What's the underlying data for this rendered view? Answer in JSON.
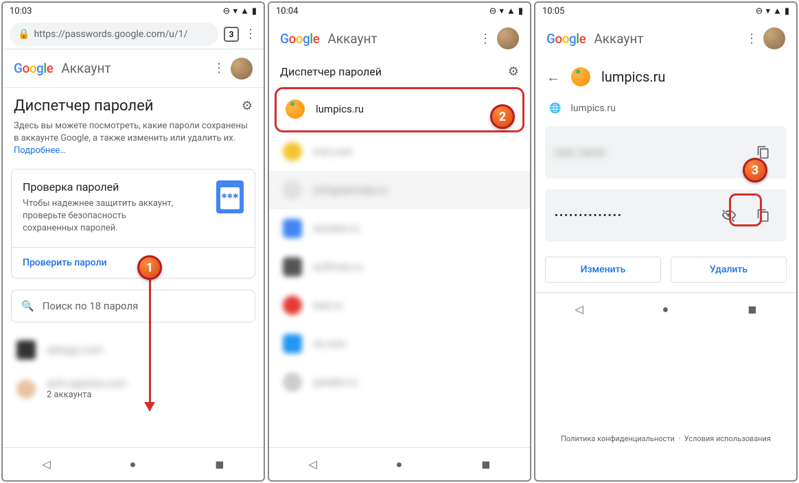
{
  "screen1": {
    "time": "10:03",
    "url": "https://passwords.google.com/u/1/",
    "tab_count": "3",
    "brand": "Аккаунт",
    "title": "Диспетчер паролей",
    "description": "Здесь вы можете посмотреть, какие пароли сохранены в аккаунте Google, а также изменить или удалить их.",
    "learn_more": "Подробнее…",
    "card": {
      "title": "Проверка паролей",
      "desc": "Чтобы надежнее защитить аккаунт, проверьте безопасность сохраненных паролей.",
      "action": "Проверить пароли"
    },
    "search_placeholder": "Поиск по 18 пароля",
    "items": [
      {
        "site": "advego.com",
        "sub": ""
      },
      {
        "site": "anti-captcha.com",
        "sub": "2 аккаунта"
      }
    ],
    "badge": "1"
  },
  "screen2": {
    "time": "10:04",
    "brand": "Аккаунт",
    "title": "Диспетчер паролей",
    "items": [
      {
        "site": "lumpics.ru"
      },
      {
        "site": "msl.com"
      },
      {
        "site": "orfogrammka.ru"
      },
      {
        "site": "rambler.ru"
      },
      {
        "site": "softmes.ru"
      },
      {
        "site": "test.ru"
      },
      {
        "site": "vk.com"
      },
      {
        "site": "yandex.ru"
      }
    ],
    "badge": "2"
  },
  "screen3": {
    "time": "10:05",
    "brand": "Аккаунт",
    "detail_title": "lumpics.ru",
    "domain": "lumpics.ru",
    "username": "user_name",
    "password_mask": "••••••••••••••",
    "edit": "Изменить",
    "delete": "Удалить",
    "privacy": "Политика конфиденциальности",
    "terms": "Условия использования",
    "badge": "3"
  }
}
